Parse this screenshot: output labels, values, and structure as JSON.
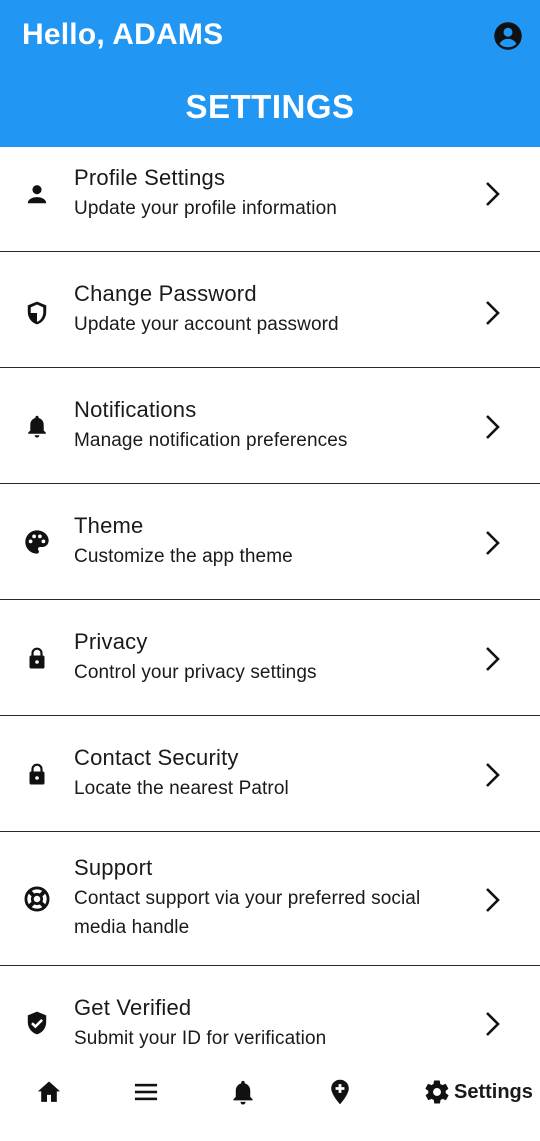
{
  "header": {
    "greeting": "Hello, ADAMS",
    "title": "SETTINGS",
    "background_color": "#2196F3",
    "account_icon": "account-circle-icon"
  },
  "settings": [
    {
      "icon": "person-icon",
      "title": "Profile Settings",
      "subtitle": "Update your profile information"
    },
    {
      "icon": "shield-icon",
      "title": "Change Password",
      "subtitle": "Update your account password"
    },
    {
      "icon": "bell-icon",
      "title": "Notifications",
      "subtitle": "Manage notification preferences"
    },
    {
      "icon": "palette-icon",
      "title": "Theme",
      "subtitle": "Customize the app theme"
    },
    {
      "icon": "lock-icon",
      "title": "Privacy",
      "subtitle": "Control your privacy settings"
    },
    {
      "icon": "lock-icon",
      "title": "Contact Security",
      "subtitle": "Locate the nearest Patrol"
    },
    {
      "icon": "lifebuoy-icon",
      "title": "Support",
      "subtitle": "Contact support via your preferred social media handle"
    },
    {
      "icon": "verified-shield-icon",
      "title": "Get Verified",
      "subtitle": "Submit your ID for verification"
    }
  ],
  "bottom_nav": {
    "items": [
      {
        "icon": "home-icon",
        "label": ""
      },
      {
        "icon": "menu-icon",
        "label": ""
      },
      {
        "icon": "bell-icon",
        "label": ""
      },
      {
        "icon": "location-add-icon",
        "label": ""
      },
      {
        "icon": "gear-icon",
        "label": "Settings"
      }
    ],
    "active": "Settings"
  }
}
